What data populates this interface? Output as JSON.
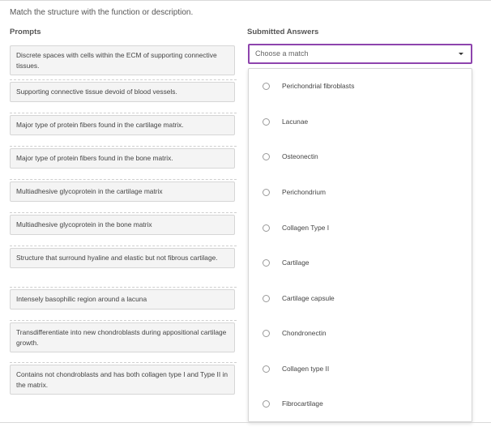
{
  "instruction": "Match the structure with the function or description.",
  "columns": {
    "prompts": "Prompts",
    "answers": "Submitted Answers"
  },
  "prompts": [
    "Discrete spaces with cells within the ECM of supporting connective tissues.",
    "Supporting connective tissue devoid of blood vessels.",
    "Major type of protein fibers found in the cartilage matrix.",
    "Major type of protein fibers found in the bone matrix.",
    "Multiadhesive glycoprotein in the cartilage matrix",
    "Multiadhesive glycoprotein in the bone matrix",
    "Structure that surround hyaline and elastic but not fibrous cartilage.",
    "Intensely basophilic region around a lacuna",
    "Transdifferentiate into new chondroblasts during appositional cartilage growth.",
    "Contains not chondroblasts and has both collagen type I and Type II in the matrix."
  ],
  "select": {
    "placeholder": "Choose a match"
  },
  "options": [
    "Perichondrial fibroblasts",
    "Lacunae",
    "Osteonectin",
    "Perichondrium",
    "Collagen Type I",
    "Cartilage",
    "Cartilage capsule",
    "Chondronectin",
    "Collagen type II",
    "Fibrocartilage"
  ],
  "colors": {
    "focus_border": "#8e44ad",
    "prompt_bg": "#f4f4f4"
  }
}
